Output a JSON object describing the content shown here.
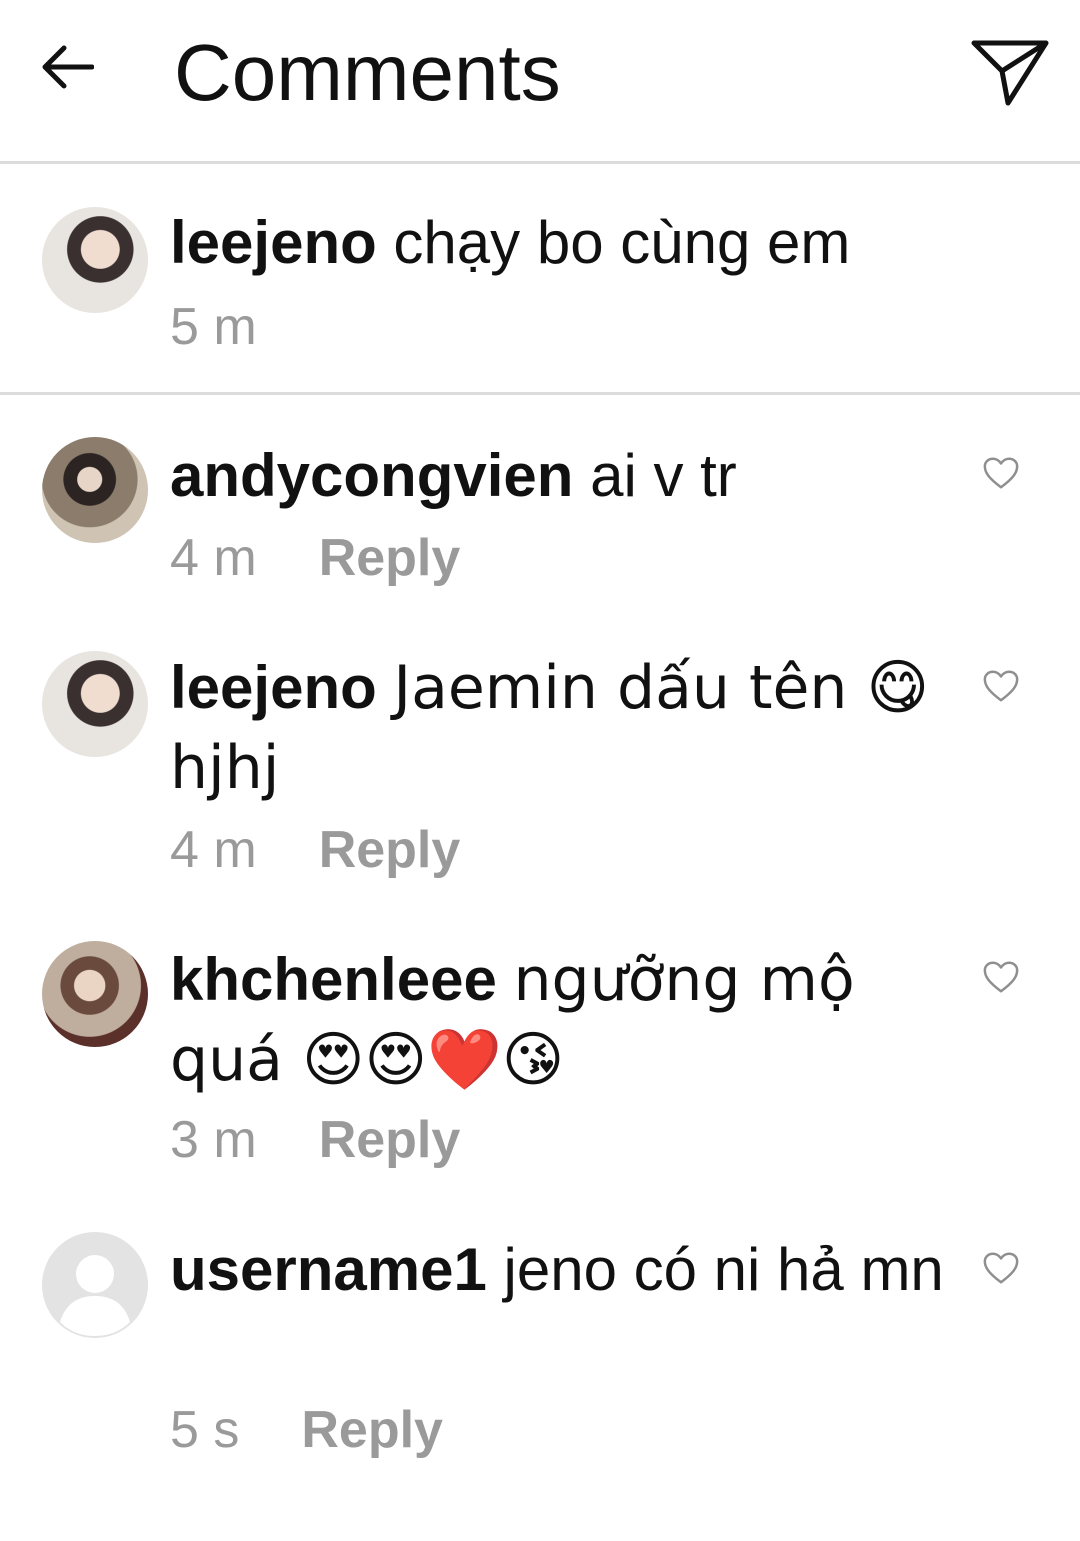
{
  "header": {
    "title": "Comments"
  },
  "caption": {
    "username": "leejeno",
    "text": "chạy bo cùng em",
    "time": "5 m"
  },
  "comments": [
    {
      "username": "andycongvien",
      "text": "ai v tr",
      "time": "4 m",
      "reply_label": "Reply"
    },
    {
      "username": "leejeno",
      "text": "Jaemin dấu tên 😋 hjhj",
      "time": "4 m",
      "reply_label": "Reply"
    },
    {
      "username": "khchenleee",
      "text": "ngưỡng mộ quá 😍😍❤️😘",
      "time": "3 m",
      "reply_label": "Reply"
    },
    {
      "username": "username1",
      "text": "jeno có ni hả mn",
      "time": "5 s",
      "reply_label": "Reply"
    }
  ],
  "icons": {
    "back": "arrow-left-icon",
    "send": "paper-plane-icon",
    "like": "heart-outline-icon"
  },
  "colors": {
    "text": "#111111",
    "secondary": "#9a9a9a",
    "divider": "#dcdcdc"
  }
}
